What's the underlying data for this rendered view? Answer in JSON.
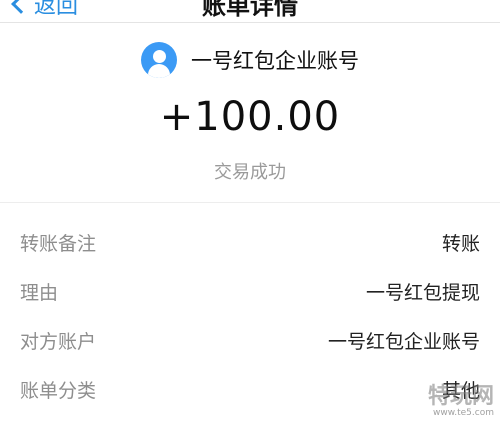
{
  "nav": {
    "back_label": "返回",
    "title": "账单详情"
  },
  "header": {
    "payer_name": "一号红包企业账号",
    "avatar_icon": "user-avatar-icon",
    "amount": "+100.00",
    "status": "交易成功"
  },
  "details": [
    {
      "label": "转账备注",
      "value": "转账"
    },
    {
      "label": "理由",
      "value": "一号红包提现"
    },
    {
      "label": "对方账户",
      "value": "一号红包企业账号"
    },
    {
      "label": "账单分类",
      "value": "其他"
    }
  ],
  "watermark": {
    "text": "特玩网",
    "url": "www.te5.com"
  },
  "colors": {
    "accent": "#2a8ee0",
    "avatar": "#3b9af5",
    "label": "#8e8e8e"
  }
}
